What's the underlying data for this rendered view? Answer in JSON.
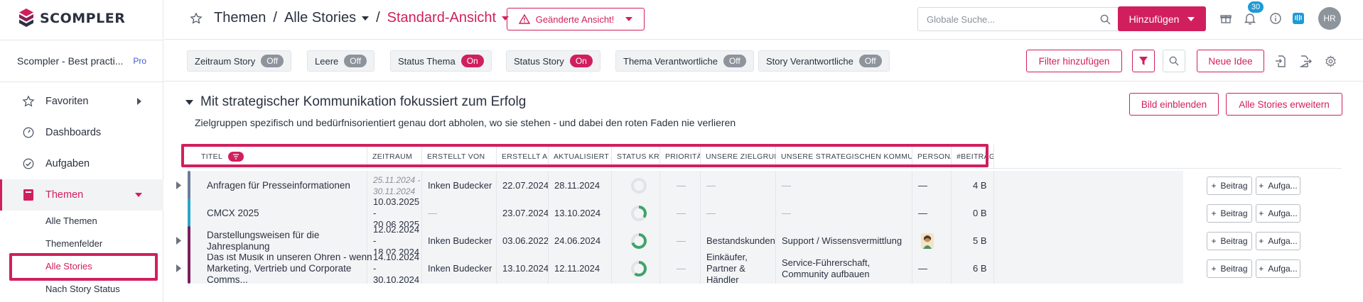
{
  "app": {
    "logo_text": "SCOMPLER"
  },
  "workspace": {
    "name": "Scompler - Best practi...",
    "plan": "Pro"
  },
  "sidebar": {
    "items": [
      {
        "label": "Favoriten",
        "icon": "star-icon"
      },
      {
        "label": "Dashboards",
        "icon": "gauge-icon"
      },
      {
        "label": "Aufgaben",
        "icon": "check-circle-icon"
      },
      {
        "label": "Themen",
        "icon": "book-icon"
      }
    ],
    "subitems": [
      {
        "label": "Alle Themen"
      },
      {
        "label": "Themenfelder"
      },
      {
        "label": "Alle Stories"
      },
      {
        "label": "Nach Story Status"
      }
    ]
  },
  "header": {
    "breadcrumb_1": "Themen",
    "breadcrumb_2": "Alle Stories",
    "breadcrumb_3": "Standard-Ansicht",
    "warning_label": "Geänderte Ansicht!",
    "search_placeholder": "Globale Suche...",
    "add_label": "Hinzufügen",
    "notification_count": "30",
    "avatar_initials": "HR"
  },
  "filters": {
    "chips": [
      {
        "label": "Zeitraum Story",
        "state": "Off"
      },
      {
        "label": "Leere",
        "state": "Off"
      },
      {
        "label": "Status Thema",
        "state": "On"
      },
      {
        "label": "Status Story",
        "state": "On"
      },
      {
        "label": "Thema Verantwortliche",
        "state": "Off"
      },
      {
        "label": "Story Verantwortliche",
        "state": "Off"
      }
    ],
    "add_filter_label": "Filter hinzufügen",
    "new_idea_label": "Neue Idee"
  },
  "section": {
    "title": "Mit strategischer Kommunikation fokussiert zum Erfolg",
    "description": "Zielgruppen spezifisch und bedürfnisorientiert genau dort abholen, wo sie stehen - und dabei den roten Faden nie verlieren",
    "show_image_label": "Bild einblenden",
    "expand_all_label": "Alle Stories erweitern"
  },
  "table": {
    "columns": [
      "TITEL",
      "ZEITRAUM",
      "ERSTELLT VON",
      "ERSTELLT AM",
      "AKTUALISIERT AM",
      "STATUS KREIS",
      "PRIORITÄT",
      "UNSERE ZIELGRUPPEN",
      "UNSERE STRATEGISCHEN KOMMUNIKATION...",
      "PERSONAS",
      "#BEITRÄGE"
    ],
    "button_beitrag": "Beitrag",
    "button_aufgabe": "Aufga...",
    "rows": [
      {
        "title": "Anfragen für Presseinformationen",
        "period_from": "25.11.2024 -",
        "period_to": "30.11.2024",
        "created_by": "Inken Budecker",
        "created_at": "22.07.2024",
        "updated_at": "28.11.2024",
        "priority": "—",
        "audiences": "—",
        "comm": "—",
        "personas": "—",
        "posts": "4 B",
        "color": "#6b7d99",
        "progress": 0
      },
      {
        "title": "CMCX 2025",
        "period_from": "10.03.2025 -",
        "period_to": "20.06.2025",
        "created_by": "—",
        "created_at": "23.07.2024",
        "updated_at": "13.10.2024",
        "priority": "—",
        "audiences": "—",
        "comm": "—",
        "personas": "—",
        "posts": "0 B",
        "color": "#2aa6c7",
        "progress": 0.35
      },
      {
        "title": "Darstellungsweisen für die Jahresplanung",
        "period_from": "12.02.2024 -",
        "period_to": "18.02.2024",
        "created_by": "Inken Budecker",
        "created_at": "03.06.2022",
        "updated_at": "24.06.2024",
        "priority": "—",
        "audiences": "Bestandskunden",
        "comm": "Support / Wissensvermittlung",
        "personas": "",
        "posts": "5 B",
        "color": "#7a1f5c",
        "progress": 0.7
      },
      {
        "title": "Das ist Musik in unseren Ohren - wenn Marketing, Vertrieb und Corporate Comms...",
        "period_from": "14.10.2024 -",
        "period_to": "30.10.2024",
        "created_by": "Inken Budecker",
        "created_at": "13.10.2024",
        "updated_at": "12.11.2024",
        "priority": "—",
        "audiences": "Einkäufer, Partner & Händler",
        "comm": "Service-Führerschaft, Community aufbauen",
        "personas": "—",
        "posts": "6 B",
        "color": "#7a1f5c",
        "progress": 0.6
      }
    ]
  }
}
